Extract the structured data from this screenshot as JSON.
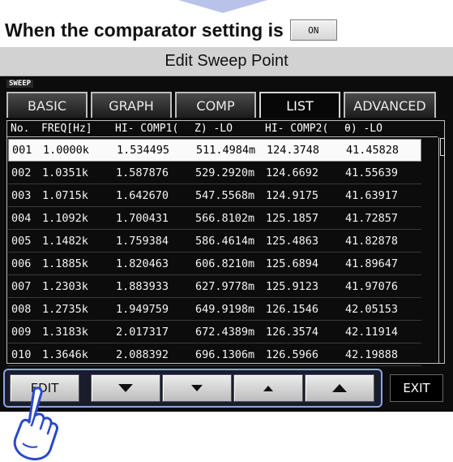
{
  "caption": {
    "text": "When the comparator setting is",
    "key_label": "ON"
  },
  "window": {
    "title": "Edit Sweep Point"
  },
  "screen": {
    "mode_label": "SWEEP",
    "tabs": [
      {
        "label": "BASIC",
        "active": false
      },
      {
        "label": "GRAPH",
        "active": false
      },
      {
        "label": "COMP",
        "active": false
      },
      {
        "label": "LIST",
        "active": true
      },
      {
        "label": "ADVANCED",
        "active": false
      }
    ],
    "table": {
      "headers": [
        "No.",
        "FREQ[Hz]",
        "HI- COMP1(",
        "Z) -LO",
        "HI- COMP2(",
        "θ) -LO"
      ],
      "rows": [
        [
          "001",
          "1.0000k",
          "1.534495",
          "511.4984m",
          "124.3748",
          "41.45828"
        ],
        [
          "002",
          "1.0351k",
          "1.587876",
          "529.2920m",
          "124.6692",
          "41.55639"
        ],
        [
          "003",
          "1.0715k",
          "1.642670",
          "547.5568m",
          "124.9175",
          "41.63917"
        ],
        [
          "004",
          "1.1092k",
          "1.700431",
          "566.8102m",
          "125.1857",
          "41.72857"
        ],
        [
          "005",
          "1.1482k",
          "1.759384",
          "586.4614m",
          "125.4863",
          "41.82878"
        ],
        [
          "006",
          "1.1885k",
          "1.820463",
          "606.8210m",
          "125.6894",
          "41.89647"
        ],
        [
          "007",
          "1.2303k",
          "1.883933",
          "627.9778m",
          "125.9123",
          "41.97076"
        ],
        [
          "008",
          "1.2735k",
          "1.949759",
          "649.9198m",
          "126.1546",
          "42.05153"
        ],
        [
          "009",
          "1.3183k",
          "2.017317",
          "672.4389m",
          "126.3574",
          "42.11914"
        ],
        [
          "010",
          "1.3646k",
          "2.088392",
          "696.1306m",
          "126.5966",
          "42.19888"
        ]
      ],
      "selected_index": 0
    },
    "buttons": {
      "edit": "EDIT",
      "exit": "EXIT"
    }
  },
  "colors": {
    "highlight": "#8ea4e4",
    "screen_bg": "#0c0c0c",
    "title_bar": "#d2d2d2"
  }
}
